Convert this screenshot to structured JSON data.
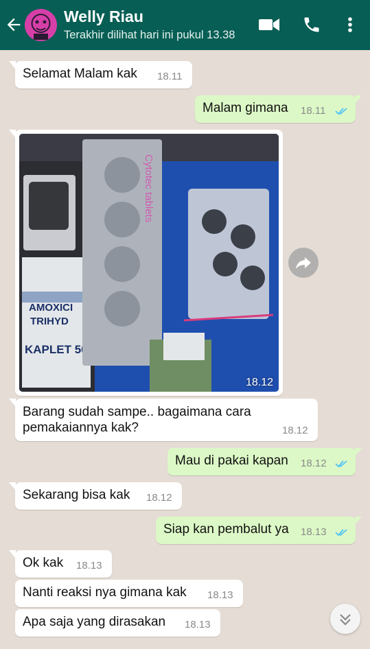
{
  "header": {
    "contact_name": "Welly Riau",
    "last_seen": "Terakhir dilihat hari ini pukul 13.38",
    "bg_color": "#075e54"
  },
  "icons": {
    "back": "arrow-left-icon",
    "video": "video-camera-icon",
    "call": "phone-icon",
    "menu": "more-vertical-icon",
    "forward": "forward-icon",
    "scroll": "chevron-double-down-icon",
    "read_receipt": "double-check-icon"
  },
  "messages": [
    {
      "direction": "in",
      "text": "Selamat Malam kak",
      "time": "18.11"
    },
    {
      "direction": "out",
      "text": "Malam gimana",
      "time": "18.11",
      "read": true
    },
    {
      "direction": "in",
      "type": "image",
      "time": "18.12"
    },
    {
      "direction": "in",
      "text_line1": "Barang sudah sampe.. bagaimana  cara",
      "text_line2": "pemakaiannya kak?",
      "time": "18.12"
    },
    {
      "direction": "out",
      "text": "Mau di pakai kapan",
      "time": "18.12",
      "read": true
    },
    {
      "direction": "in",
      "text": "Sekarang bisa kak",
      "time": "18.12"
    },
    {
      "direction": "out",
      "text": "Siap kan pembalut ya",
      "time": "18.13",
      "read": true
    },
    {
      "direction": "in",
      "text": "Ok kak",
      "time": "18.13"
    },
    {
      "direction": "in",
      "text": "Nanti reaksi nya gimana kak",
      "time": "18.13"
    },
    {
      "direction": "in",
      "text": "Apa saja yang dirasakan",
      "time": "18.13"
    }
  ],
  "photo_labels": {
    "line1": "AMOXICI",
    "line2": "TRIHYD",
    "line3": "KAPLET 50",
    "strip": "Cytotec tablets"
  },
  "colors": {
    "chat_bg": "#e5ddd5",
    "bubble_in": "#ffffff",
    "bubble_out": "#dcf8c6",
    "read_tick": "#4fc3f7"
  }
}
